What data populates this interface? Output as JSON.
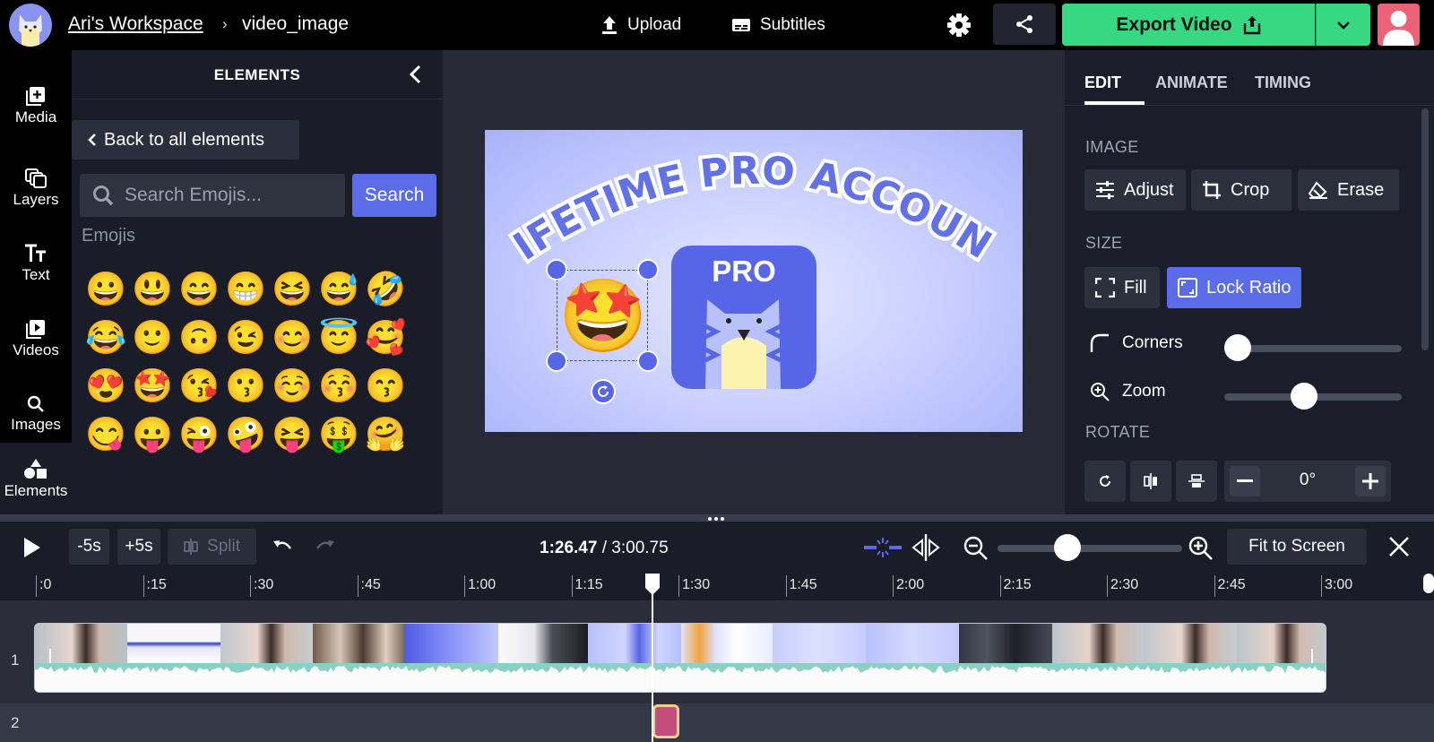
{
  "header": {
    "workspace": "Ari's Workspace",
    "separator": "›",
    "project": "video_image",
    "upload_label": "Upload",
    "subtitles_label": "Subtitles",
    "export_label": "Export Video",
    "icons": [
      "logo-icon",
      "upload-icon",
      "subtitles-icon",
      "gear-icon",
      "share-icon",
      "export-icon",
      "chevron-down-icon",
      "user-avatar"
    ]
  },
  "sidebar": {
    "items": [
      {
        "label": "Media",
        "icon": "media-plus-icon"
      },
      {
        "label": "Layers",
        "icon": "layers-icon"
      },
      {
        "label": "Text",
        "icon": "text-icon"
      },
      {
        "label": "Videos",
        "icon": "video-library-icon"
      },
      {
        "label": "Images",
        "icon": "search-icon"
      },
      {
        "label": "Elements",
        "icon": "shapes-icon"
      }
    ]
  },
  "elements_panel": {
    "title": "ELEMENTS",
    "back_label": "Back to all elements",
    "search_placeholder": "Search Emojis...",
    "search_button": "Search",
    "section_label": "Emojis",
    "emojis": [
      "😀",
      "😃",
      "😄",
      "😁",
      "😆",
      "😅",
      "🤣",
      "😂",
      "🙂",
      "🙃",
      "😉",
      "😊",
      "😇",
      "🥰",
      "😍",
      "🤩",
      "😘",
      "😗",
      "☺️",
      "😚",
      "😙",
      "😋",
      "😛",
      "😜",
      "🤪",
      "😝",
      "🤑",
      "🤗"
    ]
  },
  "canvas": {
    "headline": "LIFETIME PRO ACCOUNT",
    "badge_text": "PRO",
    "emoji": "🤩"
  },
  "right_panel": {
    "tabs": [
      "EDIT",
      "ANIMATE",
      "TIMING"
    ],
    "active_tab": "EDIT",
    "image_section": "IMAGE",
    "adjust_label": "Adjust",
    "crop_label": "Crop",
    "erase_label": "Erase",
    "size_section": "SIZE",
    "fill_label": "Fill",
    "lock_ratio_label": "Lock Ratio",
    "corners_label": "Corners",
    "corners_value": 0.0,
    "zoom_label": "Zoom",
    "zoom_value": 0.44,
    "rotate_section": "ROTATE",
    "rotate_value": "0°",
    "accent": "#5a6ce8"
  },
  "timeline": {
    "back_label": "-5s",
    "fwd_label": "+5s",
    "split_label": "Split",
    "current_time": "1:26.47",
    "time_sep": " / ",
    "total_time": "3:00.75",
    "zoom_level": 0.36,
    "fit_label": "Fit to Screen",
    "ticks": [
      ":0",
      ":15",
      ":30",
      ":45",
      "1:00",
      "1:15",
      "1:30",
      "1:45",
      "2:00",
      "2:15",
      "2:30",
      "2:45",
      "3:00"
    ],
    "track_labels": [
      "1",
      "2"
    ],
    "playhead_seconds": 86.47
  }
}
